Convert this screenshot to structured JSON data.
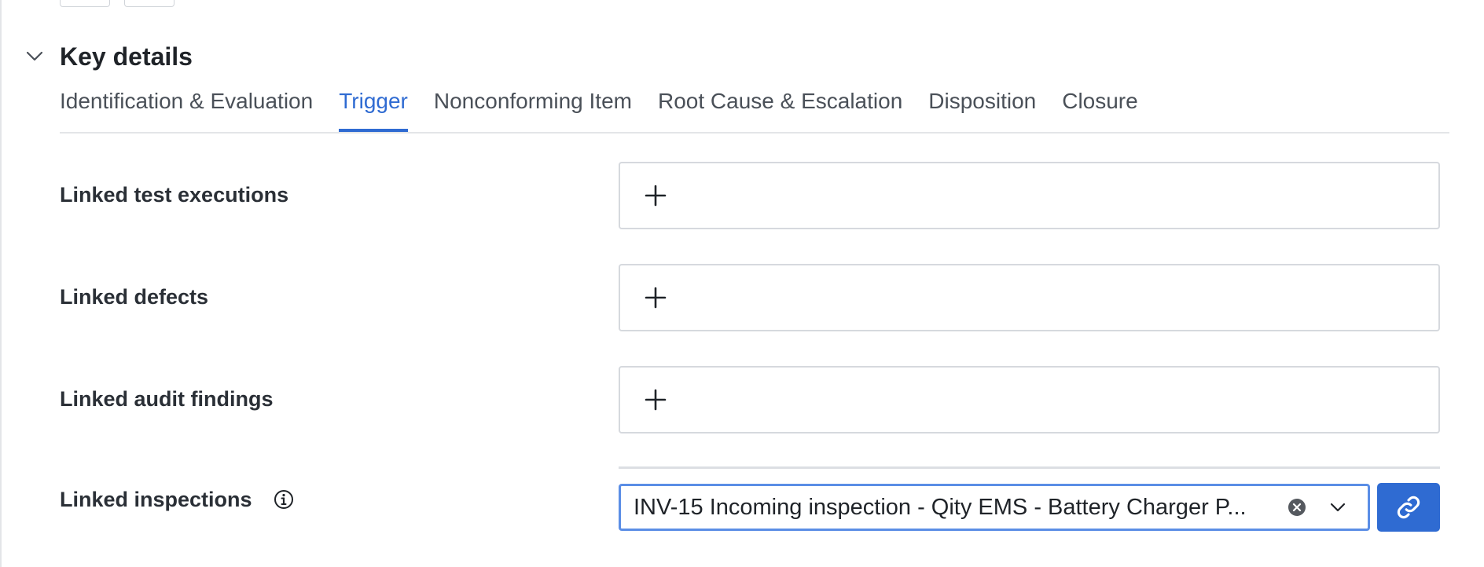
{
  "section": {
    "title": "Key details"
  },
  "tabs": [
    {
      "label": "Identification & Evaluation",
      "active": false
    },
    {
      "label": "Trigger",
      "active": true
    },
    {
      "label": "Nonconforming Item",
      "active": false
    },
    {
      "label": "Root Cause & Escalation",
      "active": false
    },
    {
      "label": "Disposition",
      "active": false
    },
    {
      "label": "Closure",
      "active": false
    }
  ],
  "fields": {
    "linked_test_executions": {
      "label": "Linked test executions"
    },
    "linked_defects": {
      "label": "Linked defects"
    },
    "linked_audit_findings": {
      "label": "Linked audit findings"
    },
    "linked_inspections": {
      "label": "Linked inspections",
      "value": "INV-15 Incoming inspection - Qity EMS - Battery Charger P..."
    }
  },
  "colors": {
    "accent": "#2f6bd2",
    "focus_border": "#5b8ee6",
    "border": "#d6d9de",
    "text": "#1f2328",
    "muted_text": "#4a5058"
  },
  "icons": {
    "collapse": "chevron-down-icon",
    "add": "plus-icon",
    "info": "info-icon",
    "clear": "clear-icon",
    "dropdown": "chevron-down-icon",
    "link": "link-icon"
  }
}
